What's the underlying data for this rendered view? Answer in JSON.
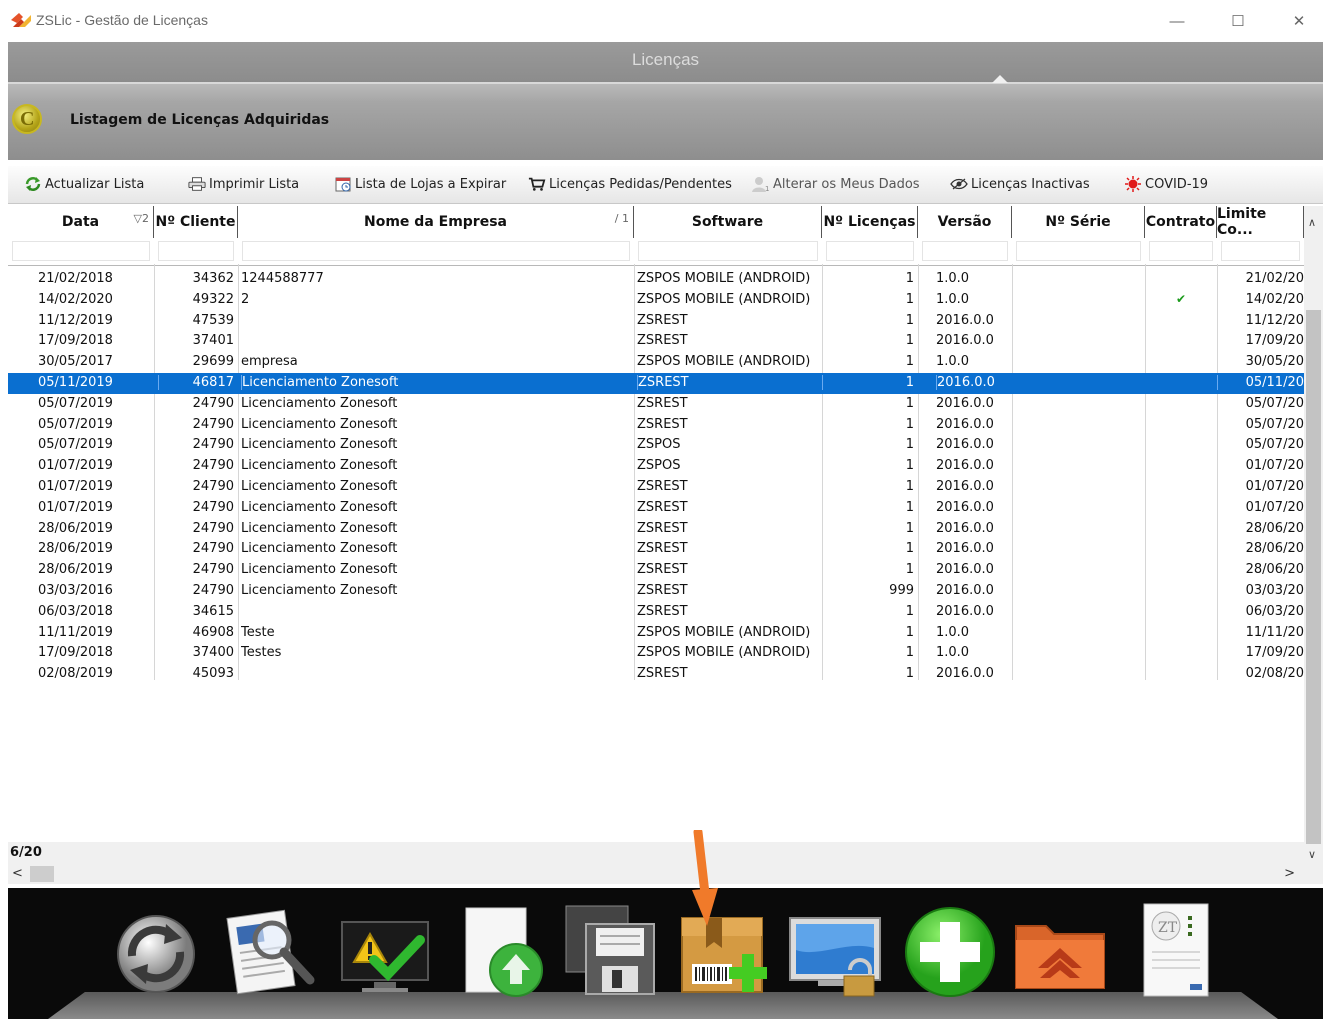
{
  "window": {
    "title": "ZSLic - Gestão de Licenças",
    "minimize": "—",
    "maximize": "☐",
    "close": "✕"
  },
  "header": {
    "section_title": "Licenças",
    "listing_title": "Listagem de Licenças Adquiridas"
  },
  "toolbar": {
    "items": [
      {
        "label": "Actualizar Lista",
        "icon": "refresh-icon"
      },
      {
        "label": "Imprimir Lista",
        "icon": "printer-icon"
      },
      {
        "label": "Lista de Lojas a Expirar",
        "icon": "calendar-icon"
      },
      {
        "label": "Licenças Pedidas/Pendentes",
        "icon": "cart-icon"
      },
      {
        "label": "Alterar os Meus Dados",
        "icon": "user-icon"
      },
      {
        "label": "Licenças Inactivas",
        "icon": "eye-icon"
      },
      {
        "label": "COVID-19",
        "icon": "virus-icon"
      }
    ]
  },
  "grid": {
    "columns": [
      {
        "label": "Data",
        "sort": "▽2"
      },
      {
        "label": "Nº Cliente",
        "sort": ""
      },
      {
        "label": "Nome da Empresa",
        "sort": "/ 1"
      },
      {
        "label": "Software",
        "sort": ""
      },
      {
        "label": "Nº Licenças",
        "sort": ""
      },
      {
        "label": "Versão",
        "sort": ""
      },
      {
        "label": "Nº Série",
        "sort": ""
      },
      {
        "label": "Contrato",
        "sort": ""
      },
      {
        "label": "Limite Co...",
        "sort": ""
      }
    ],
    "rows": [
      {
        "data": "21/02/2018",
        "cliente": "34362",
        "empresa": "1244588777",
        "software": "ZSPOS MOBILE (ANDROID)",
        "licencas": "1",
        "versao": "1.0.0",
        "serie": "",
        "contrato": "",
        "limite": "21/02/20"
      },
      {
        "data": "14/02/2020",
        "cliente": "49322",
        "empresa": "2",
        "software": "ZSPOS MOBILE (ANDROID)",
        "licencas": "1",
        "versao": "1.0.0",
        "serie": "",
        "contrato": "✔",
        "limite": "14/02/20"
      },
      {
        "data": "11/12/2019",
        "cliente": "47539",
        "empresa": "",
        "software": "ZSREST",
        "licencas": "1",
        "versao": "2016.0.0",
        "serie": "",
        "contrato": "",
        "limite": "11/12/20"
      },
      {
        "data": "17/09/2018",
        "cliente": "37401",
        "empresa": "",
        "software": "ZSREST",
        "licencas": "1",
        "versao": "2016.0.0",
        "serie": "",
        "contrato": "",
        "limite": "17/09/20"
      },
      {
        "data": "30/05/2017",
        "cliente": "29699",
        "empresa": "empresa",
        "software": "ZSPOS MOBILE (ANDROID)",
        "licencas": "1",
        "versao": "1.0.0",
        "serie": "",
        "contrato": "",
        "limite": "30/05/20"
      },
      {
        "data": "05/11/2019",
        "cliente": "46817",
        "empresa": "Licenciamento Zonesoft",
        "software": "ZSREST",
        "licencas": "1",
        "versao": "2016.0.0",
        "serie": "",
        "contrato": "",
        "limite": "05/11/20"
      },
      {
        "data": "05/07/2019",
        "cliente": "24790",
        "empresa": "Licenciamento Zonesoft",
        "software": "ZSREST",
        "licencas": "1",
        "versao": "2016.0.0",
        "serie": "",
        "contrato": "",
        "limite": "05/07/20"
      },
      {
        "data": "05/07/2019",
        "cliente": "24790",
        "empresa": "Licenciamento Zonesoft",
        "software": "ZSREST",
        "licencas": "1",
        "versao": "2016.0.0",
        "serie": "",
        "contrato": "",
        "limite": "05/07/20"
      },
      {
        "data": "05/07/2019",
        "cliente": "24790",
        "empresa": "Licenciamento Zonesoft",
        "software": "ZSPOS",
        "licencas": "1",
        "versao": "2016.0.0",
        "serie": "",
        "contrato": "",
        "limite": "05/07/20"
      },
      {
        "data": "01/07/2019",
        "cliente": "24790",
        "empresa": "Licenciamento Zonesoft",
        "software": "ZSPOS",
        "licencas": "1",
        "versao": "2016.0.0",
        "serie": "",
        "contrato": "",
        "limite": "01/07/20"
      },
      {
        "data": "01/07/2019",
        "cliente": "24790",
        "empresa": "Licenciamento Zonesoft",
        "software": "ZSREST",
        "licencas": "1",
        "versao": "2016.0.0",
        "serie": "",
        "contrato": "",
        "limite": "01/07/20"
      },
      {
        "data": "01/07/2019",
        "cliente": "24790",
        "empresa": "Licenciamento Zonesoft",
        "software": "ZSREST",
        "licencas": "1",
        "versao": "2016.0.0",
        "serie": "",
        "contrato": "",
        "limite": "01/07/20"
      },
      {
        "data": "28/06/2019",
        "cliente": "24790",
        "empresa": "Licenciamento Zonesoft",
        "software": "ZSREST",
        "licencas": "1",
        "versao": "2016.0.0",
        "serie": "",
        "contrato": "",
        "limite": "28/06/20"
      },
      {
        "data": "28/06/2019",
        "cliente": "24790",
        "empresa": "Licenciamento Zonesoft",
        "software": "ZSREST",
        "licencas": "1",
        "versao": "2016.0.0",
        "serie": "",
        "contrato": "",
        "limite": "28/06/20"
      },
      {
        "data": "28/06/2019",
        "cliente": "24790",
        "empresa": "Licenciamento Zonesoft",
        "software": "ZSREST",
        "licencas": "1",
        "versao": "2016.0.0",
        "serie": "",
        "contrato": "",
        "limite": "28/06/20"
      },
      {
        "data": "03/03/2016",
        "cliente": "24790",
        "empresa": "Licenciamento Zonesoft",
        "software": "ZSREST",
        "licencas": "999",
        "versao": "2016.0.0",
        "serie": "",
        "contrato": "",
        "limite": "03/03/20"
      },
      {
        "data": "06/03/2018",
        "cliente": "34615",
        "empresa": "",
        "software": "ZSREST",
        "licencas": "1",
        "versao": "2016.0.0",
        "serie": "",
        "contrato": "",
        "limite": "06/03/20"
      },
      {
        "data": "11/11/2019",
        "cliente": "46908",
        "empresa": "Teste",
        "software": "ZSPOS MOBILE (ANDROID)",
        "licencas": "1",
        "versao": "1.0.0",
        "serie": "",
        "contrato": "",
        "limite": "11/11/20"
      },
      {
        "data": "17/09/2018",
        "cliente": "37400",
        "empresa": "Testes",
        "software": "ZSPOS MOBILE (ANDROID)",
        "licencas": "1",
        "versao": "1.0.0",
        "serie": "",
        "contrato": "",
        "limite": "17/09/20"
      },
      {
        "data": "02/08/2019",
        "cliente": "45093",
        "empresa": "",
        "software": "ZSREST",
        "licencas": "1",
        "versao": "2016.0.0",
        "serie": "",
        "contrato": "",
        "limite": "02/08/20"
      }
    ],
    "selected_index": 5
  },
  "status": {
    "count": "6/20"
  },
  "dock": {
    "buttons": [
      "refresh-icon",
      "document-search-icon",
      "monitor-warning-icon",
      "upload-document-icon",
      "save-icon",
      "add-package-icon",
      "monitor-lock-icon",
      "add-icon",
      "folder-up-icon",
      "certificate-icon"
    ]
  },
  "colors": {
    "selection": "#0a6fd0",
    "accent_arrow": "#f07a2a"
  }
}
